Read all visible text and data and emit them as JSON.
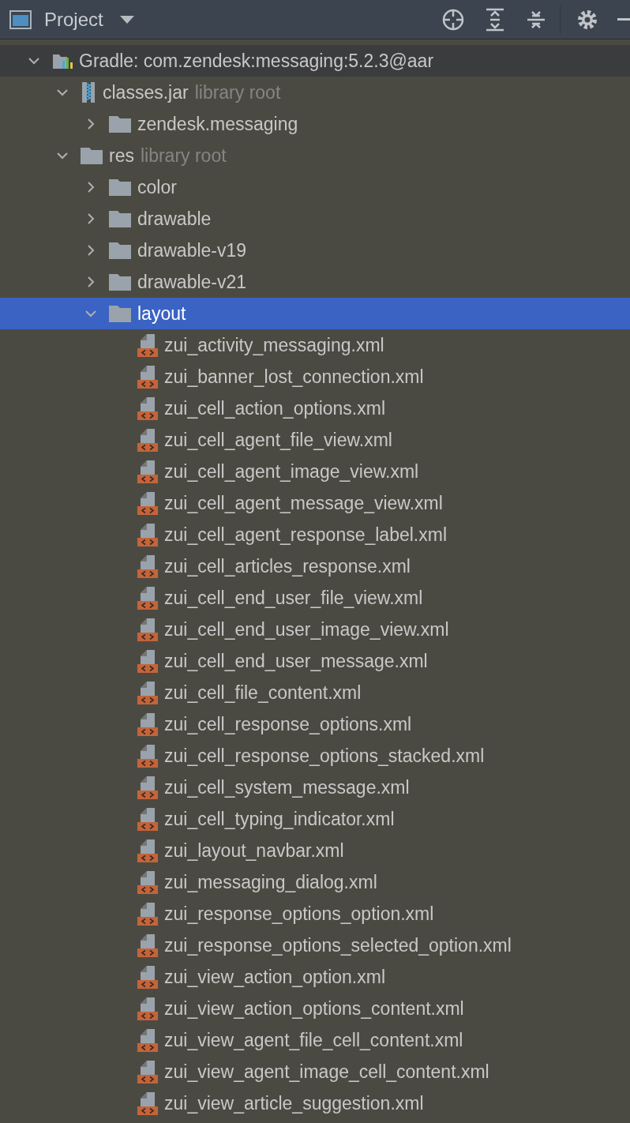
{
  "header": {
    "title": "Project"
  },
  "tree": [
    {
      "kind": "library",
      "label": "Gradle: com.zendesk:messaging:5.2.3@aar",
      "expanded": true,
      "selected": false,
      "children": [
        {
          "kind": "jar",
          "label": "classes.jar",
          "note": "library root",
          "expanded": true,
          "selected": false,
          "children": [
            {
              "kind": "folder",
              "label": "zendesk.messaging",
              "expanded": false,
              "selected": false
            }
          ]
        },
        {
          "kind": "folder",
          "label": "res",
          "note": "library root",
          "expanded": true,
          "selected": false,
          "children": [
            {
              "kind": "folder",
              "label": "color",
              "expanded": false,
              "selected": false
            },
            {
              "kind": "folder",
              "label": "drawable",
              "expanded": false,
              "selected": false
            },
            {
              "kind": "folder",
              "label": "drawable-v19",
              "expanded": false,
              "selected": false
            },
            {
              "kind": "folder",
              "label": "drawable-v21",
              "expanded": false,
              "selected": false
            },
            {
              "kind": "folder",
              "label": "layout",
              "expanded": true,
              "selected": true,
              "children": [
                {
                  "kind": "xml",
                  "label": "zui_activity_messaging.xml",
                  "selected": false
                },
                {
                  "kind": "xml",
                  "label": "zui_banner_lost_connection.xml",
                  "selected": false
                },
                {
                  "kind": "xml",
                  "label": "zui_cell_action_options.xml",
                  "selected": false
                },
                {
                  "kind": "xml",
                  "label": "zui_cell_agent_file_view.xml",
                  "selected": false
                },
                {
                  "kind": "xml",
                  "label": "zui_cell_agent_image_view.xml",
                  "selected": false
                },
                {
                  "kind": "xml",
                  "label": "zui_cell_agent_message_view.xml",
                  "selected": false
                },
                {
                  "kind": "xml",
                  "label": "zui_cell_agent_response_label.xml",
                  "selected": false
                },
                {
                  "kind": "xml",
                  "label": "zui_cell_articles_response.xml",
                  "selected": false
                },
                {
                  "kind": "xml",
                  "label": "zui_cell_end_user_file_view.xml",
                  "selected": false
                },
                {
                  "kind": "xml",
                  "label": "zui_cell_end_user_image_view.xml",
                  "selected": false
                },
                {
                  "kind": "xml",
                  "label": "zui_cell_end_user_message.xml",
                  "selected": false
                },
                {
                  "kind": "xml",
                  "label": "zui_cell_file_content.xml",
                  "selected": false
                },
                {
                  "kind": "xml",
                  "label": "zui_cell_response_options.xml",
                  "selected": false
                },
                {
                  "kind": "xml",
                  "label": "zui_cell_response_options_stacked.xml",
                  "selected": false
                },
                {
                  "kind": "xml",
                  "label": "zui_cell_system_message.xml",
                  "selected": false
                },
                {
                  "kind": "xml",
                  "label": "zui_cell_typing_indicator.xml",
                  "selected": false
                },
                {
                  "kind": "xml",
                  "label": "zui_layout_navbar.xml",
                  "selected": false
                },
                {
                  "kind": "xml",
                  "label": "zui_messaging_dialog.xml",
                  "selected": false
                },
                {
                  "kind": "xml",
                  "label": "zui_response_options_option.xml",
                  "selected": false
                },
                {
                  "kind": "xml",
                  "label": "zui_response_options_selected_option.xml",
                  "selected": false
                },
                {
                  "kind": "xml",
                  "label": "zui_view_action_option.xml",
                  "selected": false
                },
                {
                  "kind": "xml",
                  "label": "zui_view_action_options_content.xml",
                  "selected": false
                },
                {
                  "kind": "xml",
                  "label": "zui_view_agent_file_cell_content.xml",
                  "selected": false
                },
                {
                  "kind": "xml",
                  "label": "zui_view_agent_image_cell_content.xml",
                  "selected": false
                },
                {
                  "kind": "xml",
                  "label": "zui_view_article_suggestion.xml",
                  "selected": false
                }
              ]
            }
          ]
        }
      ]
    }
  ]
}
